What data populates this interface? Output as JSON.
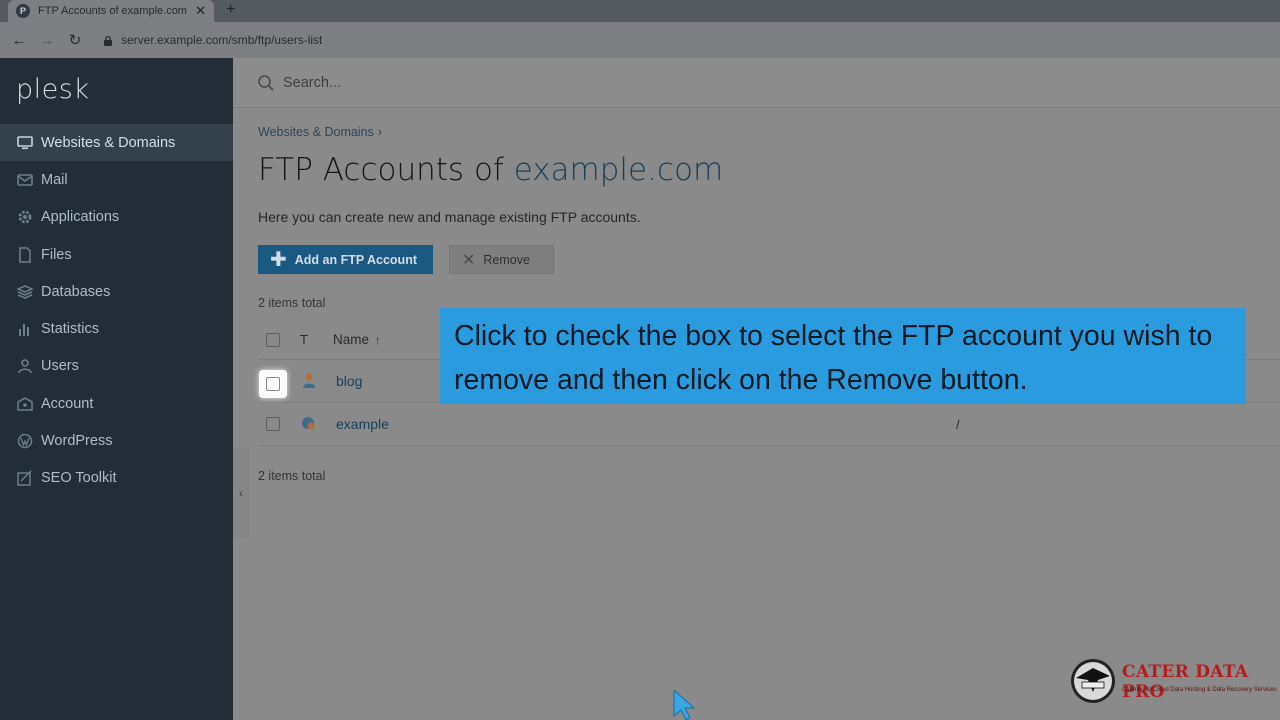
{
  "browser": {
    "tab_title": "FTP Accounts of example.com - ",
    "tab_favicon": "P",
    "tab_close": "✕",
    "new_tab": "+",
    "url": "server.example.com/smb/ftp/users-list"
  },
  "sidebar": {
    "logo": "plesk",
    "items": [
      {
        "label": "Websites & Domains",
        "icon": "monitor-icon",
        "active": true
      },
      {
        "label": "Mail",
        "icon": "envelope-icon"
      },
      {
        "label": "Applications",
        "icon": "gear-icon"
      },
      {
        "label": "Files",
        "icon": "folder-icon"
      },
      {
        "label": "Databases",
        "icon": "database-icon"
      },
      {
        "label": "Statistics",
        "icon": "bar-chart-icon"
      },
      {
        "label": "Users",
        "icon": "user-icon"
      },
      {
        "label": "Account",
        "icon": "id-card-icon"
      },
      {
        "label": "WordPress",
        "icon": "wordpress-icon"
      },
      {
        "label": "SEO Toolkit",
        "icon": "seo-icon"
      }
    ]
  },
  "search": {
    "placeholder": "Search..."
  },
  "main": {
    "breadcrumb": "Websites & Domains",
    "breadcrumb_sep": "›",
    "title_prefix": "FTP Accounts of ",
    "title_domain": "example.com",
    "description": "Here you can create new and manage existing FTP accounts.",
    "add_button": "Add an FTP Account",
    "remove_button": "Remove",
    "items_total_top": "2 items total",
    "items_total_bottom": "2 items total"
  },
  "table": {
    "col_type": "T",
    "col_name": "Name",
    "sort_arrow": "↑",
    "rows": [
      {
        "name": "blog",
        "dir": ""
      },
      {
        "name": "example",
        "dir": "/"
      }
    ]
  },
  "callout": "Click to check the box to select the FTP account you wish to remove and then click on the Remove button.",
  "watermark": {
    "brand": "CATER DATA PRO",
    "tagline": "Catering to Cloud Data Hosting & Data Recovery Services"
  },
  "colors": {
    "accent": "#2b9be0",
    "sidebar": "#222d37",
    "primary_button": "#1a5a82",
    "brand_red": "#b71c1c"
  }
}
